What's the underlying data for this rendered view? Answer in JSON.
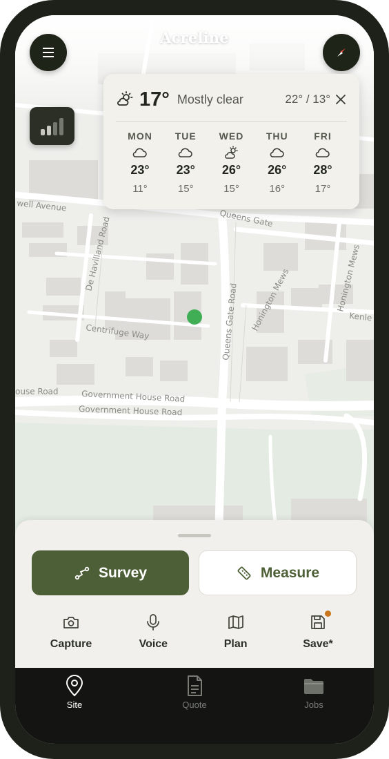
{
  "app": {
    "title": "Acreline"
  },
  "map": {
    "street_labels": [
      "well Avenue",
      "De Havilland Road",
      "Centrifuge Way",
      "Queens Gate",
      "Queens Gate Road",
      "Honington Mews",
      "Honington Mews",
      "Kenle",
      "ouse Road",
      "Government House Road",
      "Government House Road"
    ]
  },
  "weather": {
    "current_temp": "17°",
    "condition": "Mostly clear",
    "range": "22° / 13°",
    "icon": "partly-cloudy-icon",
    "forecast": [
      {
        "day": "MON",
        "icon": "cloud-icon",
        "high": "23°",
        "low": "11°"
      },
      {
        "day": "TUE",
        "icon": "cloud-icon",
        "high": "23°",
        "low": "15°"
      },
      {
        "day": "WED",
        "icon": "partly-sunny-icon",
        "high": "26°",
        "low": "15°"
      },
      {
        "day": "THU",
        "icon": "cloud-icon",
        "high": "26°",
        "low": "16°"
      },
      {
        "day": "FRI",
        "icon": "cloud-icon",
        "high": "28°",
        "low": "17°"
      }
    ]
  },
  "actions": {
    "primary": {
      "label": "Survey",
      "icon": "route-icon"
    },
    "secondary": {
      "label": "Measure",
      "icon": "ruler-icon"
    }
  },
  "tools": [
    {
      "label": "Capture",
      "icon": "camera-icon"
    },
    {
      "label": "Voice",
      "icon": "microphone-icon"
    },
    {
      "label": "Plan",
      "icon": "map-icon"
    },
    {
      "label": "Save*",
      "icon": "save-icon"
    }
  ],
  "tabs": [
    {
      "label": "Site",
      "icon": "location-pin-icon",
      "active": true
    },
    {
      "label": "Quote",
      "icon": "document-icon",
      "active": false
    },
    {
      "label": "Jobs",
      "icon": "folder-icon",
      "active": false
    }
  ],
  "colors": {
    "accent": "#4d5f36",
    "location": "#3fae55",
    "notification": "#c9761c",
    "frame": "#1d2119"
  }
}
